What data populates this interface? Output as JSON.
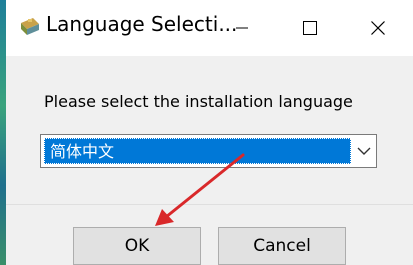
{
  "window": {
    "title": "Language Selecti...",
    "icon": "installer-app-icon"
  },
  "title_controls": [
    "minimize-icon",
    "maximize-icon",
    "close-icon"
  ],
  "dialog": {
    "prompt": "Please select the installation language",
    "language_select": {
      "selected": "简体中文",
      "arrow_icon": "chevron-down-icon"
    },
    "buttons": {
      "ok": "OK",
      "cancel": "Cancel"
    }
  },
  "colors": {
    "selection_highlight": "#0078d7",
    "annotation_arrow": "#d9282a",
    "window_background": "#f0f0f0"
  }
}
